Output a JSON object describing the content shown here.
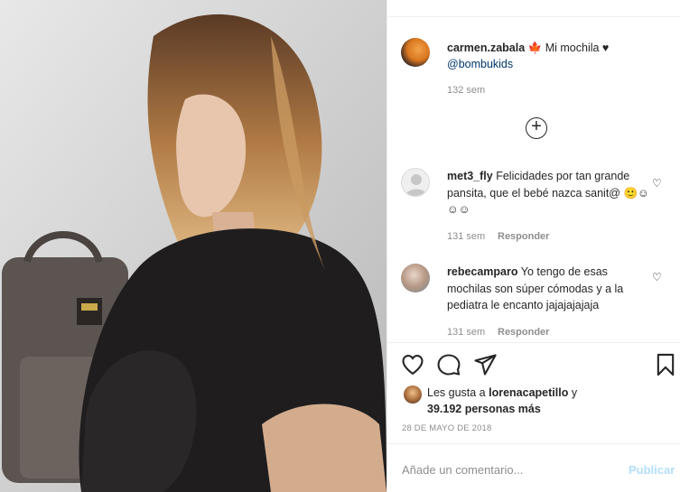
{
  "post": {
    "photo_icon": "photo-image",
    "owner": {
      "username": "carmen.zabala",
      "caption_emoji": "🍁",
      "caption": "Mi mochila ♥",
      "mention": "@bombukids",
      "time": "132 sem"
    },
    "load_more_icon": "plus-circle-icon",
    "comments": [
      {
        "username": "met3_fly",
        "text": "Felicidades por tan grande pansita, que el bebé nazca sanit@ 🙂☺☺☺",
        "time": "131 sem",
        "reply": "Responder"
      },
      {
        "username": "rebecamparo",
        "text": "Yo tengo de esas mochilas son súper cómodas y a la pediatra le encanto jajajajajaja",
        "time": "131 sem",
        "reply": "Responder"
      }
    ],
    "likes": {
      "prefix": "Les gusta a",
      "user": "lorenacapetillo",
      "join": "y",
      "count": "39.192 personas más"
    },
    "date": "28 DE MAYO DE 2018",
    "add_comment_placeholder": "Añade un comentario...",
    "publish_label": "Publicar"
  },
  "colors": {
    "text": "#262626",
    "muted": "#8e8e8e",
    "mention": "#00376b",
    "publish_disabled": "#b2dffc"
  }
}
